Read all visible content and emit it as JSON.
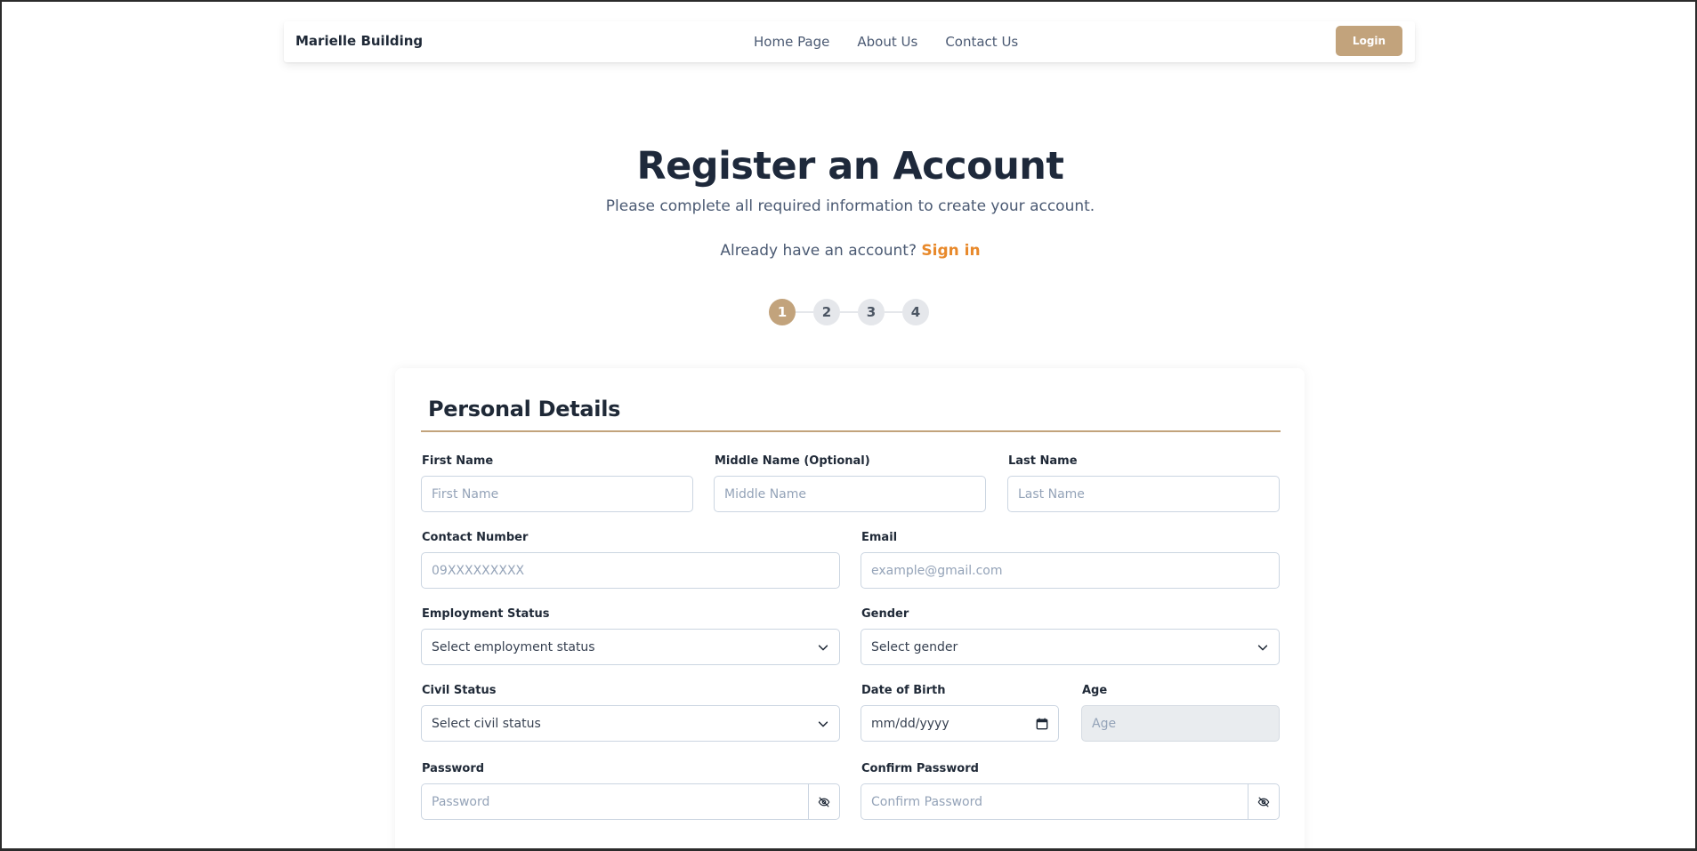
{
  "navbar": {
    "brand": "Marielle Building",
    "links": [
      "Home Page",
      "About Us",
      "Contact Us"
    ],
    "login_label": "Login"
  },
  "header": {
    "title": "Register an Account",
    "subtitle": "Please complete all required information to create your account.",
    "signin_prompt": "Already have an account?",
    "signin_link": "Sign in"
  },
  "stepper": {
    "steps": [
      "1",
      "2",
      "3",
      "4"
    ],
    "current": 1
  },
  "form": {
    "section_title": "Personal Details",
    "first_name": {
      "label": "First Name",
      "placeholder": "First Name"
    },
    "middle_name": {
      "label": "Middle Name (Optional)",
      "placeholder": "Middle Name"
    },
    "last_name": {
      "label": "Last Name",
      "placeholder": "Last Name"
    },
    "contact": {
      "label": "Contact Number",
      "placeholder": "09XXXXXXXXX"
    },
    "email": {
      "label": "Email",
      "placeholder": "example@gmail.com"
    },
    "employment": {
      "label": "Employment Status",
      "value": "Select employment status"
    },
    "gender": {
      "label": "Gender",
      "value": "Select gender"
    },
    "civil": {
      "label": "Civil Status",
      "value": "Select civil status"
    },
    "dob": {
      "label": "Date of Birth",
      "value": "mm/dd/yyyy"
    },
    "age": {
      "label": "Age",
      "placeholder": "Age"
    },
    "password": {
      "label": "Password",
      "placeholder": "Password"
    },
    "confirm_password": {
      "label": "Confirm Password",
      "placeholder": "Confirm Password"
    }
  },
  "icons": {
    "select_arrow": "chevron-down-icon",
    "calendar": "calendar-icon",
    "password_toggle": "eye-off-icon"
  },
  "colors": {
    "accent": "#c2a37c",
    "link": "#e8892b",
    "heading": "#1e293b",
    "muted": "#4b5a73"
  }
}
